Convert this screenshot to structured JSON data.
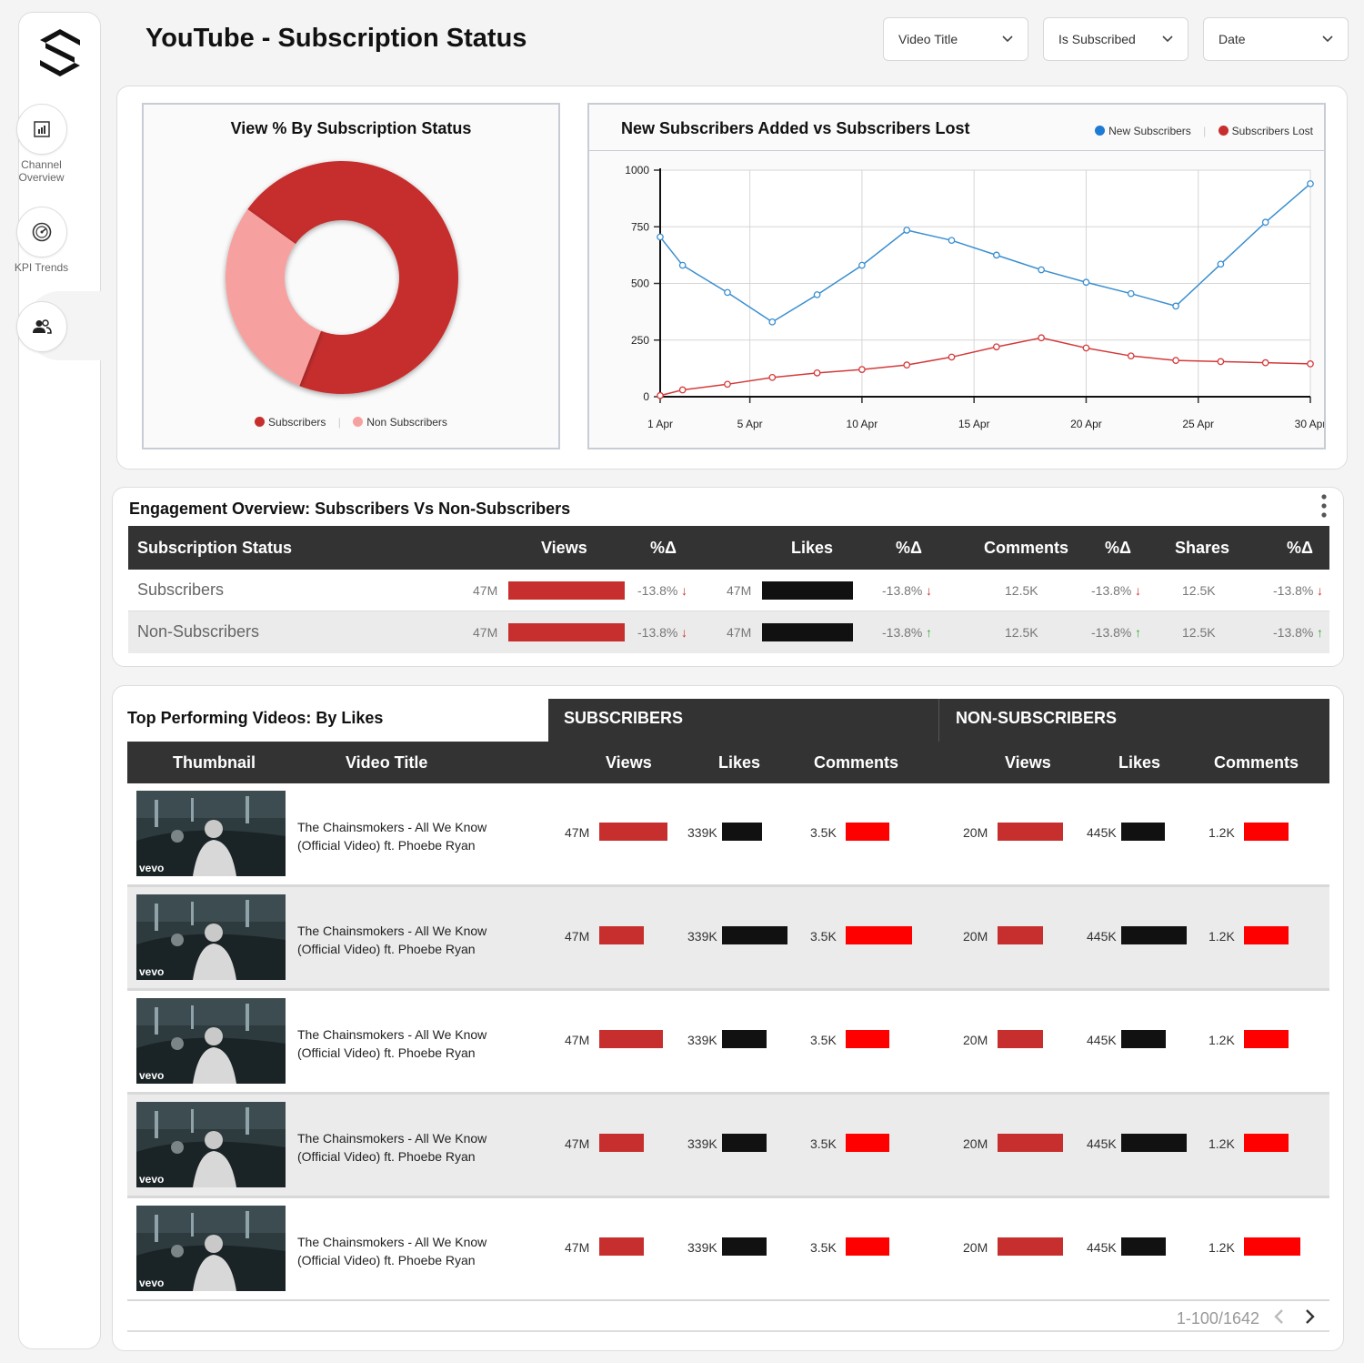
{
  "sidebar": {
    "items": [
      {
        "label": "Channel Overview",
        "icon": "bar-chart-icon"
      },
      {
        "label": "KPI Trends",
        "icon": "gauge-icon"
      },
      {
        "label": "",
        "icon": "users-icon"
      }
    ]
  },
  "header": {
    "title": "YouTube - Subscription Status",
    "filters": [
      "Video Title",
      "Is Subscribed",
      "Date"
    ]
  },
  "donut": {
    "title": "View % By Subscription Status",
    "legend": [
      "Subscribers",
      "Non Subscribers"
    ]
  },
  "line": {
    "title": "New Subscribers Added vs Subscribers Lost",
    "legend": [
      "New Subscribers",
      "Subscribers Lost"
    ]
  },
  "chart_data": [
    {
      "type": "pie",
      "title": "View % By Subscription Status",
      "categories": [
        "Subscribers",
        "Non Subscribers"
      ],
      "values": [
        71,
        29
      ],
      "colors": [
        "#c62f2d",
        "#f6a19f"
      ]
    },
    {
      "type": "line",
      "title": "New Subscribers Added vs Subscribers Lost",
      "x": [
        "1 Apr",
        "2 Apr",
        "4 Apr",
        "6 Apr",
        "8 Apr",
        "10 Apr",
        "12 Apr",
        "14 Apr",
        "16 Apr",
        "18 Apr",
        "20 Apr",
        "22 Apr",
        "24 Apr",
        "26 Apr",
        "28 Apr",
        "30 Apr"
      ],
      "x_ticks": [
        "1 Apr",
        "5 Apr",
        "10 Apr",
        "15 Apr",
        "20 Apr",
        "25 Apr",
        "30 Apr"
      ],
      "ylim": [
        0,
        1000
      ],
      "y_ticks": [
        0,
        250,
        500,
        750,
        1000
      ],
      "series": [
        {
          "name": "New Subscribers",
          "color": "#3a8fd0",
          "values": [
            705,
            580,
            460,
            330,
            450,
            580,
            735,
            690,
            625,
            560,
            505,
            455,
            400,
            585,
            770,
            940
          ]
        },
        {
          "name": "Subscribers Lost",
          "color": "#d43a3a",
          "values": [
            5,
            30,
            55,
            85,
            105,
            120,
            140,
            175,
            220,
            260,
            215,
            180,
            160,
            155,
            150,
            145
          ]
        }
      ],
      "grid": true,
      "legend": "top-right"
    }
  ],
  "engagement": {
    "title": "Engagement Overview: Subscribers Vs Non-Subscribers",
    "headers": [
      "Subscription Status",
      "Views",
      "%Δ",
      "Likes",
      "%Δ",
      "Comments",
      "%Δ",
      "Shares",
      "%Δ"
    ],
    "rows": [
      {
        "status": "Subscribers",
        "views": "47M",
        "views_d": "-13.8%",
        "likes": "47M",
        "likes_d": "-13.8%",
        "comments": "12.5K",
        "comments_d": "-13.8%",
        "shares": "12.5K",
        "shares_d": "-13.8%",
        "arrows": [
          "down",
          "down",
          "down",
          "down"
        ]
      },
      {
        "status": "Non-Subscribers",
        "views": "47M",
        "views_d": "-13.8%",
        "likes": "47M",
        "likes_d": "-13.8%",
        "comments": "12.5K",
        "comments_d": "-13.8%",
        "shares": "12.5K",
        "shares_d": "-13.8%",
        "arrows": [
          "down",
          "up",
          "up",
          "up"
        ]
      }
    ]
  },
  "top": {
    "title": "Top Performing Videos: By Likes",
    "group_headers": [
      "SUBSCRIBERS",
      "NON-SUBSCRIBERS"
    ],
    "headers": [
      "Thumbnail",
      "Video Title",
      "Views",
      "Likes",
      "Comments",
      "Views",
      "Likes",
      "Comments"
    ],
    "thumb_badge": "vevo",
    "rows": [
      {
        "title1": "The Chainsmokers - All We Know",
        "title2": "(Official Video) ft. Phoebe Ryan",
        "s_views": "47M",
        "s_likes": "339K",
        "s_comments": "3.5K",
        "n_views": "20M",
        "n_likes": "445K",
        "n_comments": "1.2K"
      },
      {
        "title1": "The Chainsmokers - All We Know",
        "title2": "(Official Video) ft. Phoebe Ryan",
        "s_views": "47M",
        "s_likes": "339K",
        "s_comments": "3.5K",
        "n_views": "20M",
        "n_likes": "445K",
        "n_comments": "1.2K"
      },
      {
        "title1": "The Chainsmokers - All We Know",
        "title2": "(Official Video) ft. Phoebe Ryan",
        "s_views": "47M",
        "s_likes": "339K",
        "s_comments": "3.5K",
        "n_views": "20M",
        "n_likes": "445K",
        "n_comments": "1.2K"
      },
      {
        "title1": "The Chainsmokers - All We Know",
        "title2": "(Official Video) ft. Phoebe Ryan",
        "s_views": "47M",
        "s_likes": "339K",
        "s_comments": "3.5K",
        "n_views": "20M",
        "n_likes": "445K",
        "n_comments": "1.2K"
      },
      {
        "title1": "The Chainsmokers - All We Know",
        "title2": "(Official Video) ft. Phoebe Ryan",
        "s_views": "47M",
        "s_likes": "339K",
        "s_comments": "3.5K",
        "n_views": "20M",
        "n_likes": "445K",
        "n_comments": "1.2K"
      }
    ],
    "pagination": "1-100/1642"
  },
  "colors": {
    "accent_red": "#c62f2d",
    "bright_red": "#ff0000",
    "dark": "#333333",
    "bar_black": "#111111"
  }
}
